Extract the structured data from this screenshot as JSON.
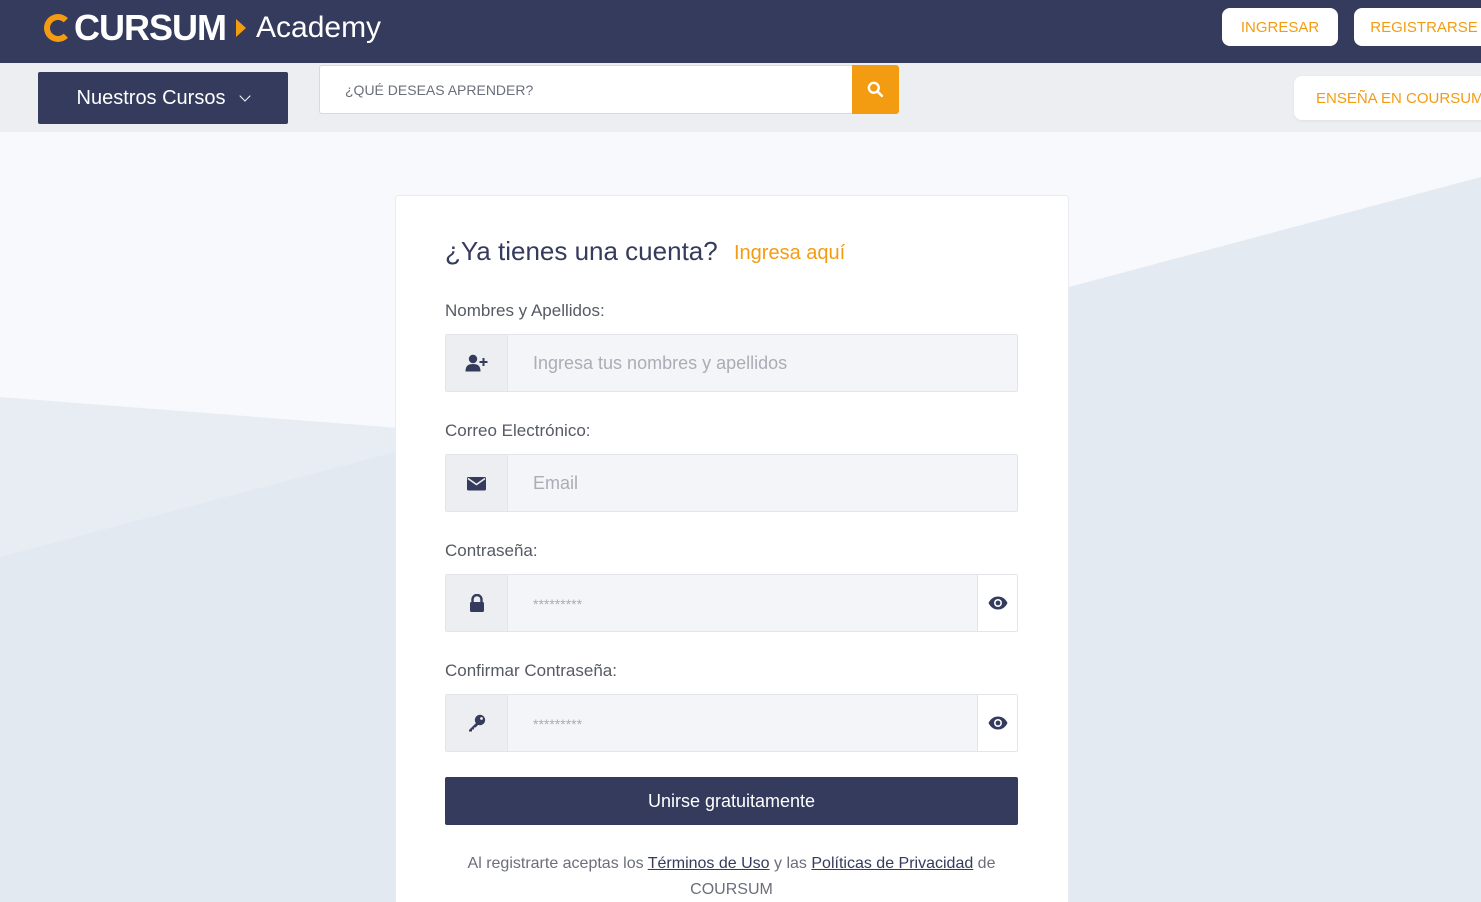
{
  "header": {
    "brand": "CURSUM",
    "product": "Academy",
    "login_label": "INGRESAR",
    "register_label": "REGISTRARSE"
  },
  "subnav": {
    "courses_label": "Nuestros Cursos",
    "search_placeholder": "¿QUÉ DESEAS APRENDER?",
    "teach_label": "ENSEÑA EN COURSUM"
  },
  "form": {
    "title": "¿Ya tienes una cuenta?",
    "login_link": "Ingresa aquí",
    "fields": [
      {
        "label": "Nombres y Apellidos:",
        "placeholder": "Ingresa tus nombres y apellidos",
        "icon": "user-plus-icon"
      },
      {
        "label": "Correo Electrónico:",
        "placeholder": "Email",
        "icon": "envelope-icon"
      },
      {
        "label": "Contraseña:",
        "placeholder": "*********",
        "icon": "lock-icon",
        "toggle_icon": "eye-icon"
      },
      {
        "label": "Confirmar Contraseña:",
        "placeholder": "*********",
        "icon": "key-icon",
        "toggle_icon": "eye-icon"
      }
    ],
    "submit_label": "Unirse gratuitamente",
    "terms": {
      "prefix": "Al registrarte aceptas los ",
      "terms_link": "Términos de Uso",
      "middle": " y las ",
      "privacy_link": "Políticas de Privacidad",
      "suffix": " de COURSUM"
    }
  },
  "colors": {
    "navy": "#343b5c",
    "accent": "#f39c12"
  }
}
